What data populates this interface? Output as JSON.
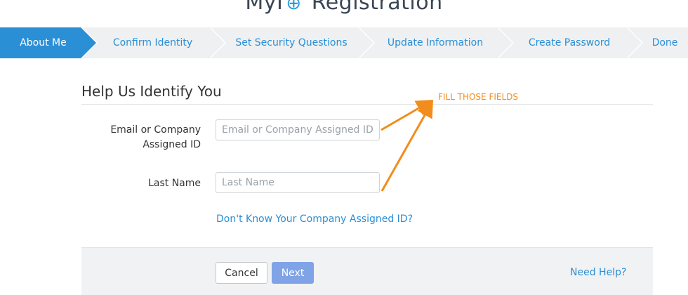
{
  "header": {
    "title_prefix": "MyI",
    "title_suffix": "Registration"
  },
  "steps": [
    {
      "label": "About Me",
      "active": true
    },
    {
      "label": "Confirm Identity",
      "active": false
    },
    {
      "label": "Set Security Questions",
      "active": false
    },
    {
      "label": "Update Information",
      "active": false
    },
    {
      "label": "Create Password",
      "active": false
    },
    {
      "label": "Done",
      "active": false
    }
  ],
  "form": {
    "section_title": "Help Us Identify You",
    "email_label_line1": "Email or Company",
    "email_label_line2": "Assigned ID",
    "email_placeholder": "Email or Company Assigned ID",
    "email_value": "",
    "lastname_label": "Last Name",
    "lastname_placeholder": "Last Name",
    "lastname_value": "",
    "id_help_link": "Don't Know Your Company Assigned ID?"
  },
  "annotation": {
    "text": "FILL THOSE FIELDS",
    "color": "#f28c1c"
  },
  "footer": {
    "cancel_label": "Cancel",
    "next_label": "Next",
    "help_link": "Need Help?"
  },
  "colors": {
    "accent": "#2b8fd6",
    "next_button": "#7fa3e6"
  }
}
